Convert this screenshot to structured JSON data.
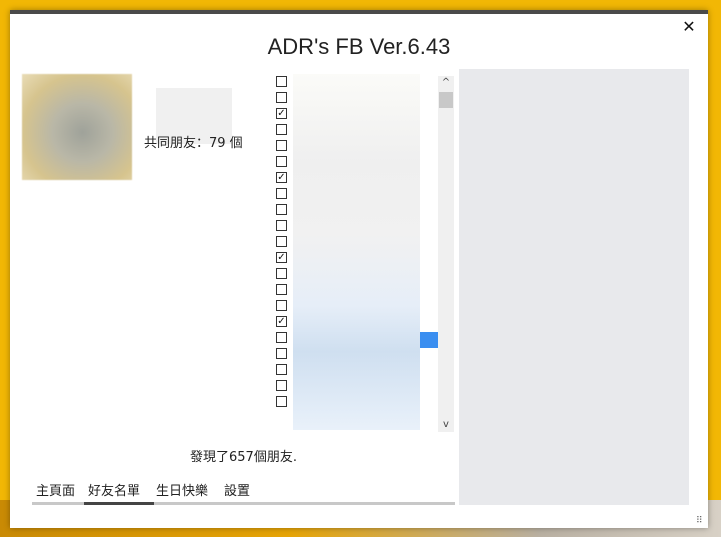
{
  "window": {
    "title": "ADR's FB Ver.6.43",
    "close_glyph": "✕"
  },
  "profile": {
    "mutual_friends": "共同朋友：79 個"
  },
  "friends_list": {
    "checkboxes": [
      false,
      false,
      true,
      false,
      false,
      false,
      true,
      false,
      false,
      false,
      false,
      true,
      false,
      false,
      false,
      true,
      false,
      false,
      false,
      false,
      false
    ]
  },
  "scroll": {
    "up_glyph": "^",
    "down_glyph": "v"
  },
  "status": {
    "found_text": "發現了657個朋友."
  },
  "tabs": [
    {
      "label": "主頁面"
    },
    {
      "label": "好友名單",
      "active": true
    },
    {
      "label": "生日快樂"
    },
    {
      "label": "設置"
    }
  ],
  "colors": {
    "accent": "#3a8ef0",
    "desktop": "#f2b705"
  }
}
